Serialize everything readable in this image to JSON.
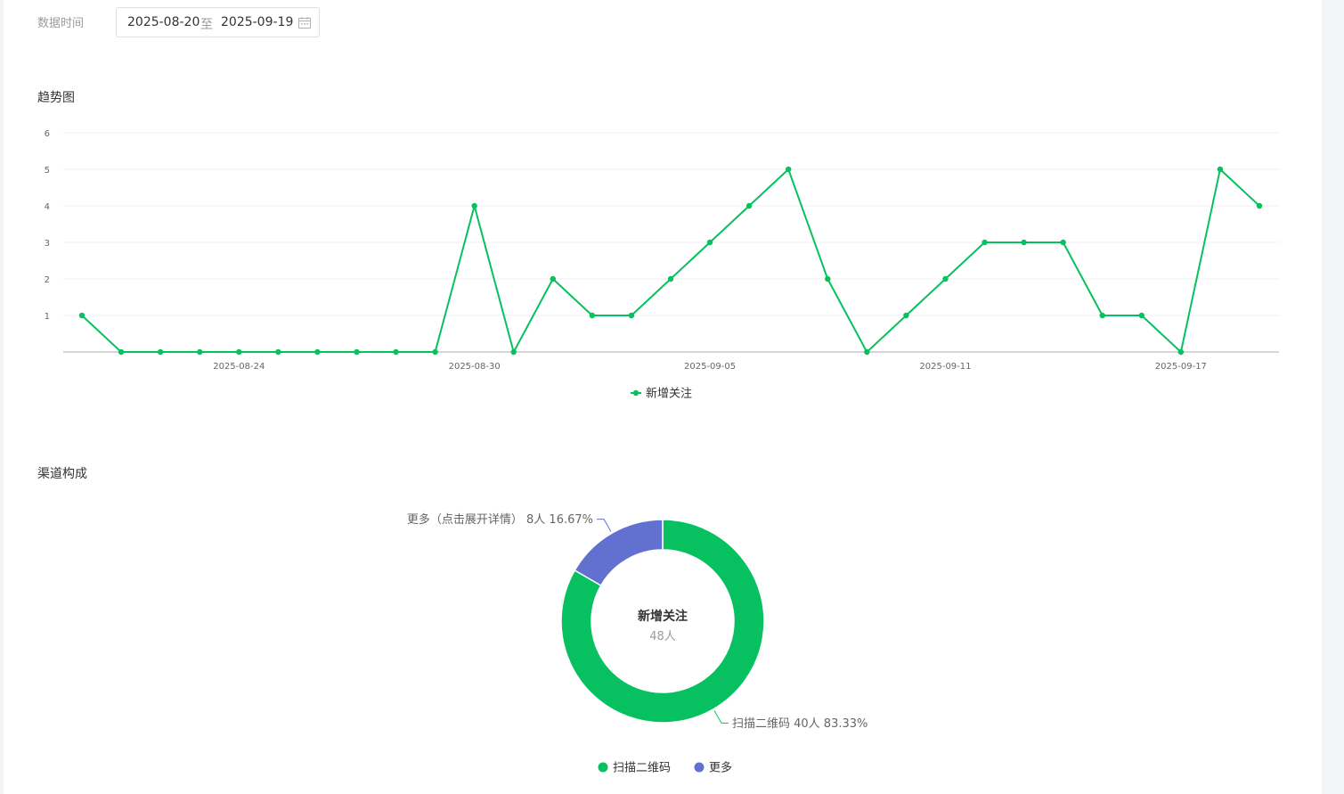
{
  "filter": {
    "label": "数据时间",
    "start_date": "2025-08-20",
    "separator": "至",
    "end_date": "2025-09-19"
  },
  "trend_section": {
    "title": "趋势图"
  },
  "channel_section": {
    "title": "渠道构成"
  },
  "chart_data": [
    {
      "type": "line",
      "title": "趋势图",
      "x": [
        "2025-08-20",
        "2025-08-21",
        "2025-08-22",
        "2025-08-23",
        "2025-08-24",
        "2025-08-25",
        "2025-08-26",
        "2025-08-27",
        "2025-08-28",
        "2025-08-29",
        "2025-08-30",
        "2025-08-31",
        "2025-09-01",
        "2025-09-02",
        "2025-09-03",
        "2025-09-04",
        "2025-09-05",
        "2025-09-06",
        "2025-09-07",
        "2025-09-08",
        "2025-09-09",
        "2025-09-10",
        "2025-09-11",
        "2025-09-12",
        "2025-09-13",
        "2025-09-14",
        "2025-09-15",
        "2025-09-16",
        "2025-09-17",
        "2025-09-18",
        "2025-09-19"
      ],
      "x_tick_labels": [
        "2025-08-24",
        "2025-08-30",
        "2025-09-05",
        "2025-09-11",
        "2025-09-17"
      ],
      "y_tick_labels": [
        "1",
        "2",
        "3",
        "4",
        "5",
        "6"
      ],
      "ylim": [
        0,
        6
      ],
      "series": [
        {
          "name": "新增关注",
          "color": "#07c160",
          "values": [
            1,
            0,
            0,
            0,
            0,
            0,
            0,
            0,
            0,
            0,
            4,
            0,
            2,
            1,
            1,
            2,
            3,
            4,
            5,
            2,
            0,
            1,
            2,
            3,
            3,
            3,
            1,
            1,
            0,
            5,
            4
          ]
        }
      ],
      "grid": true,
      "legend": "bottom-center"
    },
    {
      "type": "pie",
      "title": "渠道构成",
      "center_title": "新增关注",
      "center_value": "48人",
      "slices": [
        {
          "name": "扫描二维码",
          "value": 40,
          "label": "扫描二维码 40人 83.33%",
          "color": "#07c160"
        },
        {
          "name": "更多",
          "value": 8,
          "label": "更多（点击展开详情） 8人 16.67%",
          "color": "#6271cf"
        }
      ],
      "legend": "bottom-center"
    }
  ]
}
